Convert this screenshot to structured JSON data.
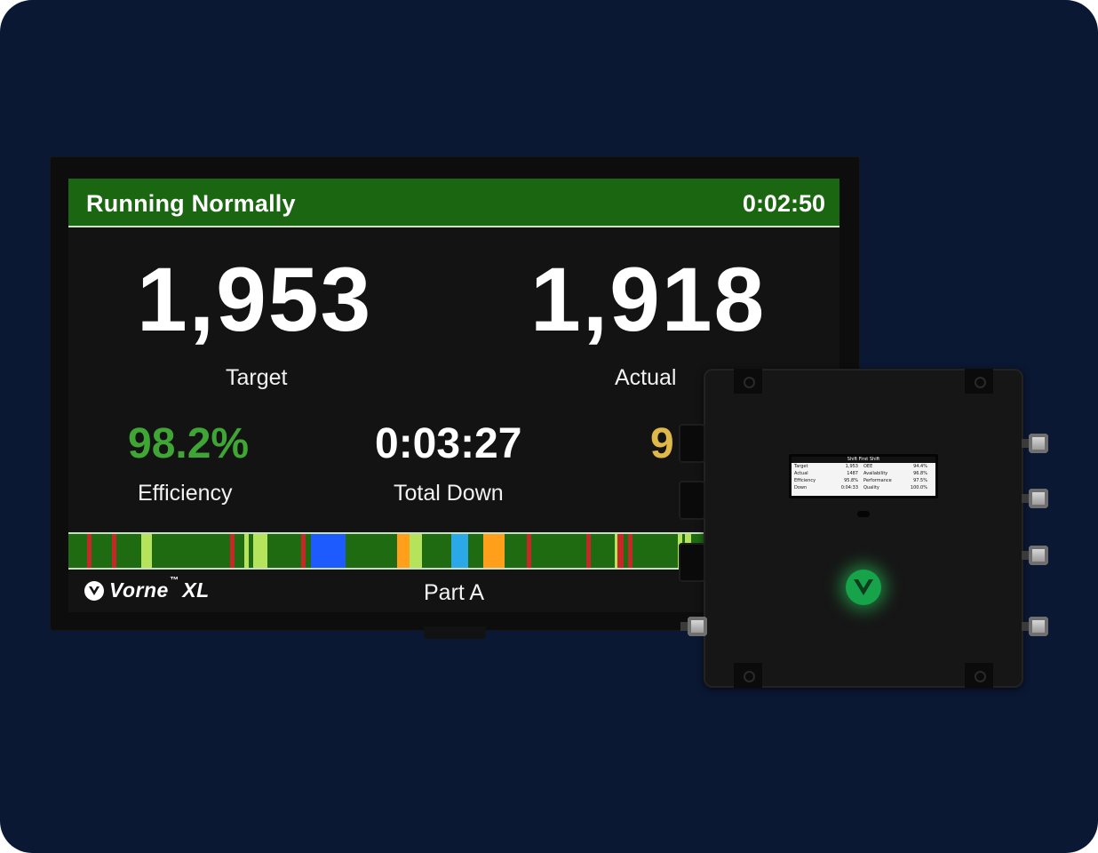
{
  "screen": {
    "status": "Running Normally",
    "timer": "0:02:50",
    "target_value": "1,953",
    "target_label": "Target",
    "actual_value": "1,918",
    "actual_label": "Actual",
    "efficiency_value": "98.2%",
    "efficiency_label": "Efficiency",
    "down_value": "0:03:27",
    "down_label": "Total Down",
    "third_metric_partial": "9",
    "brand": "Vorne",
    "brand_tm": "™",
    "brand_suffix": "XL",
    "part": "Part A"
  },
  "colors": {
    "background": "#0b1833",
    "status_green": "#1a6611",
    "efficiency_green": "#3fa535",
    "third_metric_yellow": "#e0b84a",
    "timeline_green": "#1e6b12",
    "timeline_red": "#c62828",
    "timeline_lime": "#b5e35b",
    "timeline_blue": "#1e5bff",
    "timeline_cyan": "#2aa8e8",
    "timeline_orange": "#ff9f1a"
  },
  "timeline_segments": [
    {
      "start": 0.024,
      "end": 0.03,
      "state": "red"
    },
    {
      "start": 0.056,
      "end": 0.062,
      "state": "red"
    },
    {
      "start": 0.094,
      "end": 0.108,
      "state": "lime"
    },
    {
      "start": 0.21,
      "end": 0.216,
      "state": "red"
    },
    {
      "start": 0.228,
      "end": 0.234,
      "state": "lime"
    },
    {
      "start": 0.24,
      "end": 0.258,
      "state": "lime"
    },
    {
      "start": 0.302,
      "end": 0.308,
      "state": "red"
    },
    {
      "start": 0.314,
      "end": 0.36,
      "state": "blue"
    },
    {
      "start": 0.426,
      "end": 0.442,
      "state": "orange"
    },
    {
      "start": 0.442,
      "end": 0.458,
      "state": "lime"
    },
    {
      "start": 0.496,
      "end": 0.518,
      "state": "cyan"
    },
    {
      "start": 0.538,
      "end": 0.566,
      "state": "orange"
    },
    {
      "start": 0.594,
      "end": 0.6,
      "state": "red"
    },
    {
      "start": 0.672,
      "end": 0.678,
      "state": "red"
    },
    {
      "start": 0.708,
      "end": 0.712,
      "state": "lime"
    },
    {
      "start": 0.712,
      "end": 0.72,
      "state": "red"
    },
    {
      "start": 0.726,
      "end": 0.732,
      "state": "red"
    },
    {
      "start": 0.79,
      "end": 0.796,
      "state": "lime"
    },
    {
      "start": 0.8,
      "end": 0.808,
      "state": "lime"
    }
  ],
  "device_lcd": {
    "header": "Shift First Shift",
    "rows": [
      [
        "Target",
        "1,953",
        "OEE",
        "94.4%"
      ],
      [
        "Actual",
        "1487",
        "Availability",
        "96.8%"
      ],
      [
        "Efficiency",
        "95.8%",
        "Performance",
        "97.5%"
      ],
      [
        "Down",
        "0:04:33",
        "Quality",
        "100.0%"
      ]
    ]
  }
}
